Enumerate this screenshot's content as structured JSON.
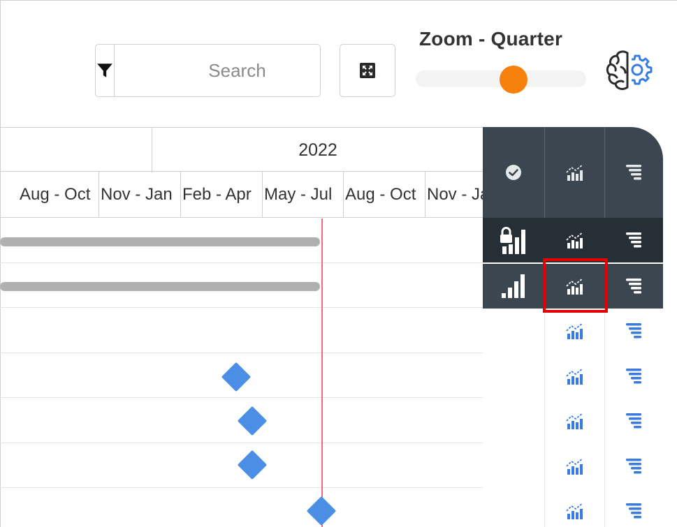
{
  "toolbar": {
    "filter_icon": "filter-icon",
    "search": {
      "placeholder": "Search",
      "value": ""
    },
    "expand_icon": "expand-icon"
  },
  "zoom": {
    "label": "Zoom - Quarter",
    "level": 0.5,
    "accent_color": "#f5800b"
  },
  "ai_button": {
    "icon": "brain-gear-icon"
  },
  "timeline": {
    "year": "2022",
    "quarters": [
      "Aug - Oct",
      "Nov - Jan",
      "Feb - Apr",
      "May - Jul",
      "Aug - Oct",
      "Nov - Jan"
    ],
    "today_line_color": "#f26b78",
    "bar_color": "#b0b0b0",
    "milestone_color": "#4a8ee6"
  },
  "panel": {
    "header_color": "#3c4650",
    "header_icons": [
      "check-circle-icon",
      "bar-chart-trend-icon",
      "tornado-icon"
    ],
    "rows": [
      {
        "status": "lock-bars-icon",
        "chart": "bar-chart-trend-icon",
        "tornado": "tornado-icon",
        "style": "dark"
      },
      {
        "status": "signal-bars-icon",
        "chart": "bar-chart-trend-icon",
        "tornado": "tornado-icon",
        "style": "slate",
        "selected": "chart"
      },
      {
        "status": "",
        "chart": "bar-chart-trend-icon",
        "tornado": "tornado-icon",
        "style": "light"
      },
      {
        "status": "",
        "chart": "bar-chart-trend-icon",
        "tornado": "tornado-icon",
        "style": "light"
      },
      {
        "status": "",
        "chart": "bar-chart-trend-icon",
        "tornado": "tornado-icon",
        "style": "light"
      },
      {
        "status": "",
        "chart": "bar-chart-trend-icon",
        "tornado": "tornado-icon",
        "style": "light"
      },
      {
        "status": "",
        "chart": "bar-chart-trend-icon",
        "tornado": "tornado-icon",
        "style": "light"
      }
    ],
    "highlight_color": "#e60000",
    "link_icon_color": "#3a7be0"
  }
}
